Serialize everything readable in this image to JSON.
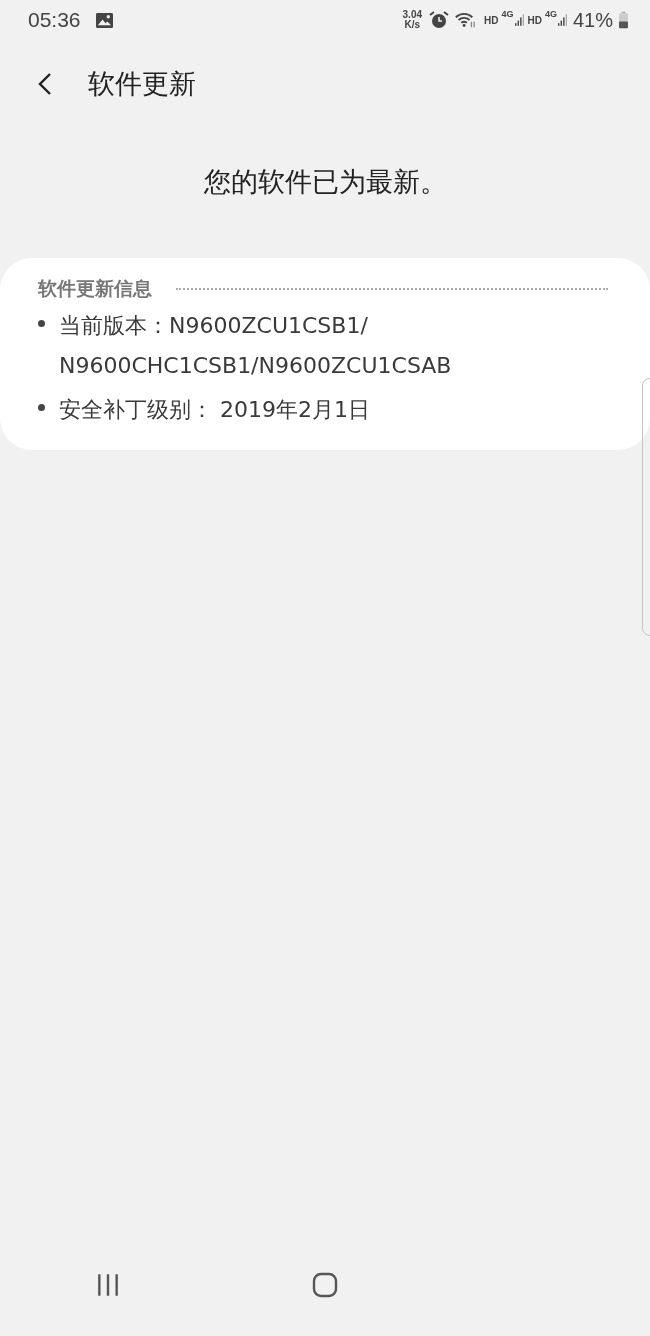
{
  "status_bar": {
    "time": "05:36",
    "speed_value": "3.04",
    "speed_unit": "K/s",
    "sims": [
      {
        "hd": "HD",
        "network": "4G"
      },
      {
        "hd": "HD",
        "network": "4G"
      }
    ],
    "battery": "41%"
  },
  "header": {
    "title": "软件更新"
  },
  "message": "您的软件已为最新。",
  "info": {
    "title": "软件更新信息",
    "items": [
      {
        "lines": [
          "当前版本：N9600ZCU1CSB1/",
          "N9600CHC1CSB1/N9600ZCU1CSAB"
        ]
      },
      {
        "lines": [
          "安全补丁级别： 2019年2月1日"
        ]
      }
    ]
  }
}
